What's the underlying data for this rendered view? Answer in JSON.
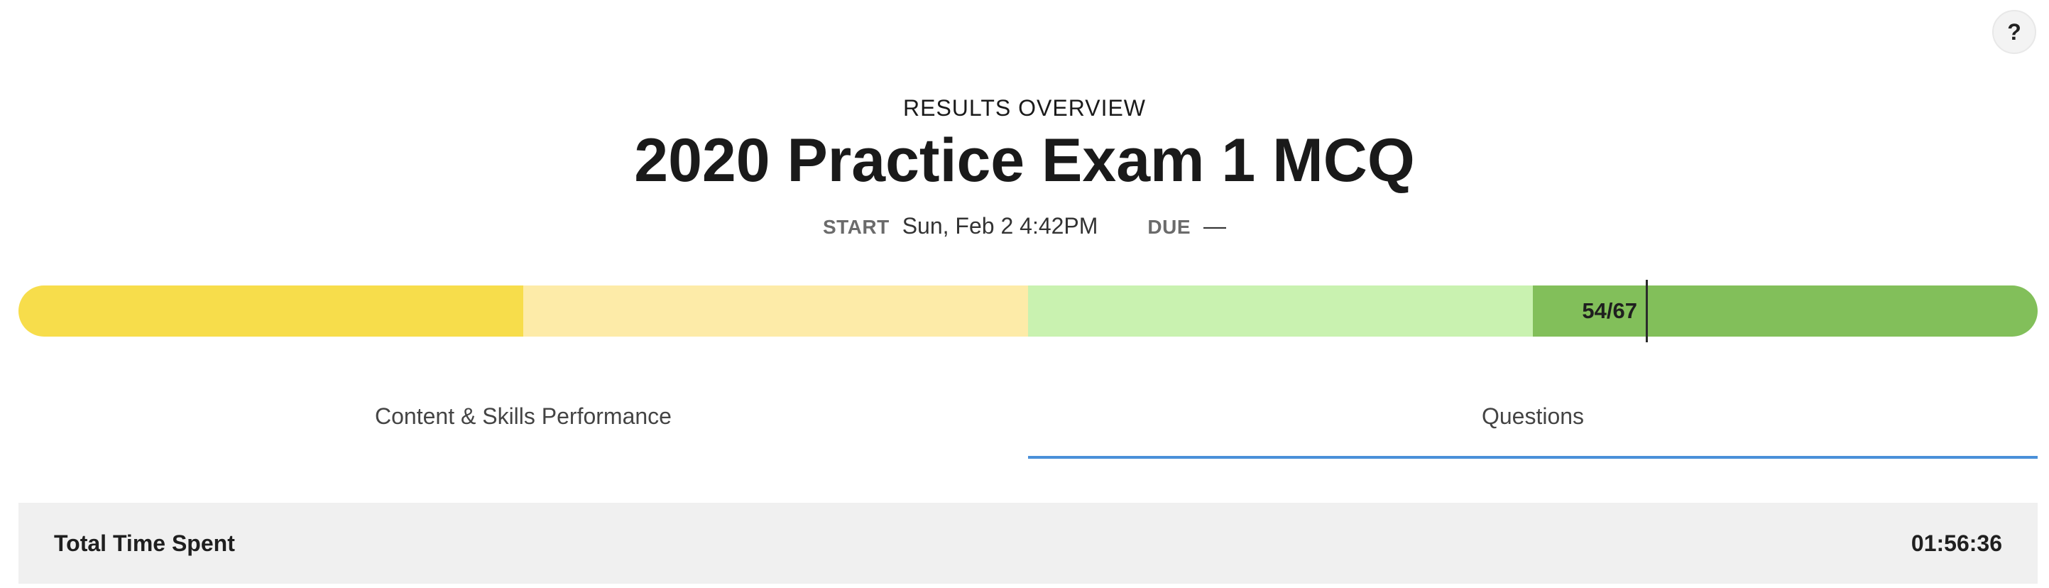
{
  "help": {
    "label": "?"
  },
  "header": {
    "overline": "RESULTS OVERVIEW",
    "title": "2020 Practice Exam 1 MCQ",
    "start_label": "START",
    "start_value": "Sun, Feb 2 4:42PM",
    "due_label": "DUE",
    "due_value": "—"
  },
  "score": {
    "label": "54/67",
    "correct": 54,
    "total": 67,
    "segments": [
      {
        "color": "#f7dd4b"
      },
      {
        "color": "#fdeba8"
      },
      {
        "color": "#c9f2b0"
      },
      {
        "color": "#82bf5a"
      }
    ]
  },
  "tabs": [
    {
      "label": "Content & Skills Performance",
      "active": false
    },
    {
      "label": "Questions",
      "active": true
    }
  ],
  "summary": {
    "time_label": "Total Time Spent",
    "time_value": "01:56:36"
  },
  "colors": {
    "tab_underline": "#4a90d9",
    "panel_bg": "#f0f0f0"
  }
}
